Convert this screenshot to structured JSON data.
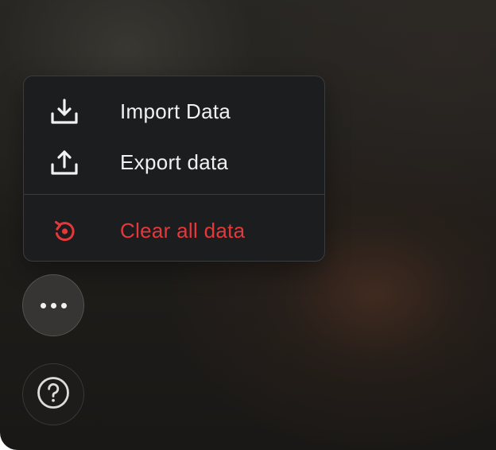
{
  "menu": {
    "items": [
      {
        "label": "Import Data",
        "icon": "download-tray-icon"
      },
      {
        "label": "Export data",
        "icon": "upload-tray-icon"
      },
      {
        "label": "Clear all data",
        "icon": "reset-icon",
        "color": "#e5383b"
      }
    ]
  },
  "buttons": {
    "more": {
      "icon": "more-horizontal-icon"
    },
    "help": {
      "icon": "help-circle-icon"
    }
  },
  "colors": {
    "menu_background": "#1c1d1f",
    "menu_text": "#f1f1f1",
    "danger": "#e5383b"
  }
}
